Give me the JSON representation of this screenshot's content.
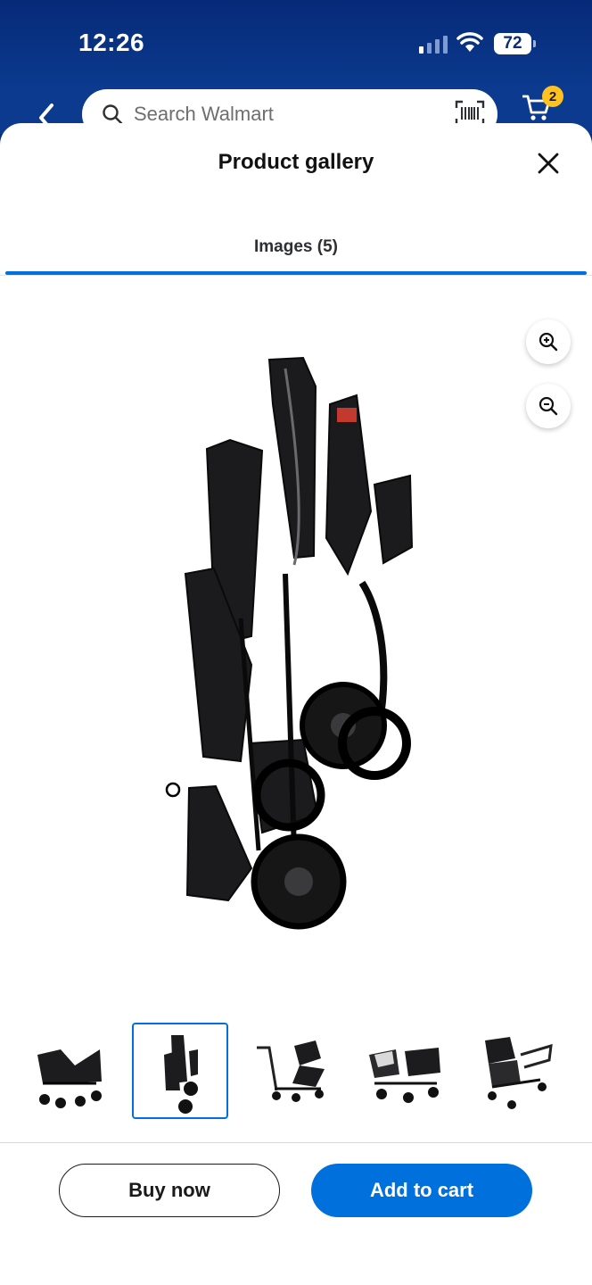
{
  "status_bar": {
    "time": "12:26",
    "battery": "72"
  },
  "header": {
    "search_placeholder": "Search Walmart",
    "cart_count": "2"
  },
  "gallery": {
    "title": "Product gallery",
    "tab_label": "Images (5)",
    "selected_index": 1,
    "thumbnails": [
      "stroller-front-view",
      "stroller-folded-side-view",
      "stroller-side-view",
      "stroller-with-car-seats",
      "stroller-angled-view"
    ]
  },
  "actions": {
    "buy_now": "Buy now",
    "add_to_cart": "Add to cart"
  },
  "colors": {
    "brand_blue": "#0071dc",
    "header_blue": "#0b3a8e",
    "spark_yellow": "#ffc220"
  }
}
